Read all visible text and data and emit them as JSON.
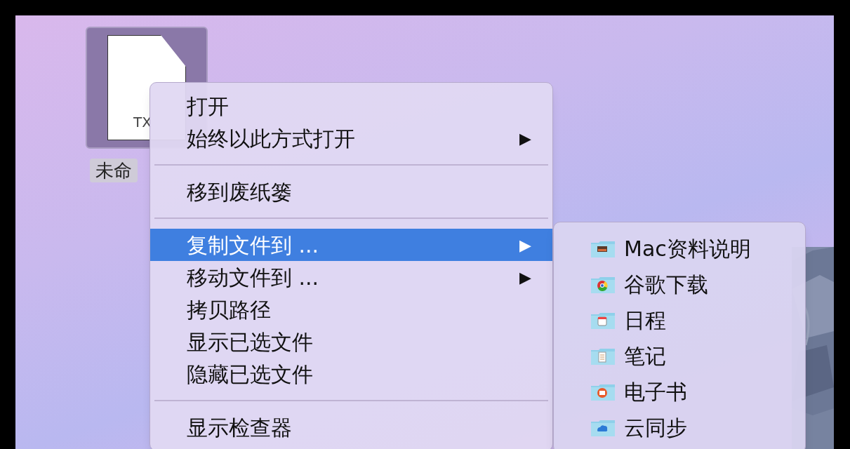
{
  "desktop": {
    "file": {
      "type_label": "TX",
      "name": "未命",
      "selected": true
    }
  },
  "context_menu": {
    "items": [
      {
        "kind": "item",
        "label": "打开",
        "submenu": false,
        "selected": false
      },
      {
        "kind": "item",
        "label": "始终以此方式打开",
        "submenu": true,
        "selected": false
      },
      {
        "kind": "separator"
      },
      {
        "kind": "item",
        "label": "移到废纸篓",
        "submenu": false,
        "selected": false
      },
      {
        "kind": "separator"
      },
      {
        "kind": "item",
        "label": "复制文件到 ...",
        "submenu": true,
        "selected": true
      },
      {
        "kind": "item",
        "label": "移动文件到 ...",
        "submenu": true,
        "selected": false
      },
      {
        "kind": "item",
        "label": "拷贝路径",
        "submenu": false,
        "selected": false
      },
      {
        "kind": "item",
        "label": "显示已选文件",
        "submenu": false,
        "selected": false
      },
      {
        "kind": "item",
        "label": "隐藏已选文件",
        "submenu": false,
        "selected": false
      },
      {
        "kind": "separator"
      },
      {
        "kind": "item",
        "label": "显示检查器",
        "submenu": false,
        "selected": false
      }
    ],
    "arrow": "▶"
  },
  "submenu": {
    "items": [
      {
        "label": "Mac资料说明"
      },
      {
        "label": "谷歌下载"
      },
      {
        "label": "日程"
      },
      {
        "label": "笔记"
      },
      {
        "label": "电子书"
      },
      {
        "label": "云同步"
      }
    ]
  }
}
